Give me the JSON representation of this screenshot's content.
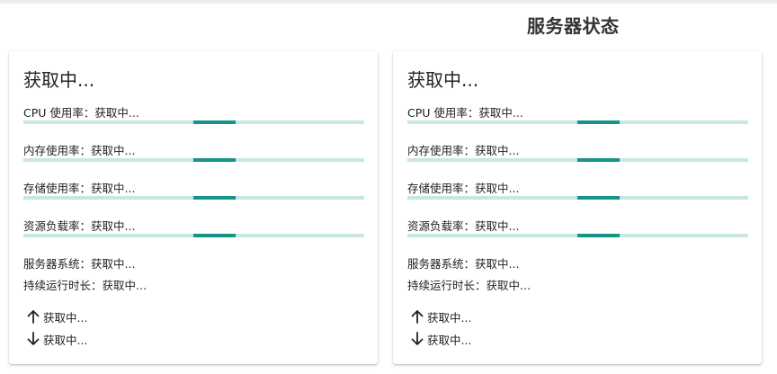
{
  "page": {
    "title": "服务器状态"
  },
  "servers": [
    {
      "title": "获取中...",
      "cpu": {
        "label": "CPU 使用率：获取中..."
      },
      "memory": {
        "label": "内存使用率：获取中..."
      },
      "storage": {
        "label": "存储使用率：获取中..."
      },
      "load": {
        "label": "资源负载率：获取中..."
      },
      "system": "服务器系统：获取中...",
      "uptime": "持续运行时长：获取中...",
      "upload": "获取中...",
      "download": "获取中..."
    },
    {
      "title": "获取中...",
      "cpu": {
        "label": "CPU 使用率：获取中..."
      },
      "memory": {
        "label": "内存使用率：获取中..."
      },
      "storage": {
        "label": "存储使用率：获取中..."
      },
      "load": {
        "label": "资源负载率：获取中..."
      },
      "system": "服务器系统：获取中...",
      "uptime": "持续运行时长：获取中...",
      "upload": "获取中...",
      "download": "获取中..."
    }
  ],
  "progress_state": "indeterminate",
  "colors": {
    "accent": "#159586",
    "track": "#c8e6e3"
  },
  "icons": {
    "upload": "arrow-up-icon",
    "download": "arrow-down-icon"
  }
}
